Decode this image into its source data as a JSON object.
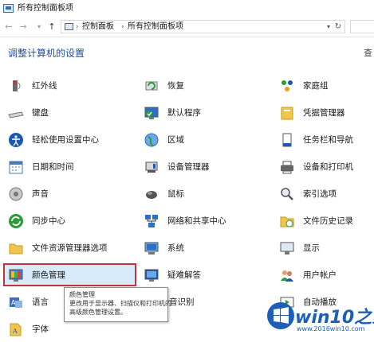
{
  "window": {
    "title": "所有控制面板项"
  },
  "nav": {
    "back": "←",
    "forward": "→",
    "up": "↑"
  },
  "address": {
    "crumbs": [
      "控制面板",
      "所有控制面板项"
    ],
    "separator": "›",
    "dropdown": "▾",
    "refresh": "↻"
  },
  "heading": "调整计算机的设置",
  "view_by": "查",
  "items": [
    {
      "label": "红外线",
      "icon": "infrared-icon"
    },
    {
      "label": "恢复",
      "icon": "recovery-icon"
    },
    {
      "label": "家庭组",
      "icon": "homegroup-icon"
    },
    {
      "label": "键盘",
      "icon": "keyboard-icon"
    },
    {
      "label": "默认程序",
      "icon": "default-programs-icon"
    },
    {
      "label": "凭据管理器",
      "icon": "credential-manager-icon"
    },
    {
      "label": "轻松使用设置中心",
      "icon": "ease-of-access-icon"
    },
    {
      "label": "区域",
      "icon": "region-icon"
    },
    {
      "label": "任务栏和导航",
      "icon": "taskbar-icon"
    },
    {
      "label": "日期和时间",
      "icon": "date-time-icon"
    },
    {
      "label": "设备管理器",
      "icon": "device-manager-icon"
    },
    {
      "label": "设备和打印机",
      "icon": "devices-printers-icon"
    },
    {
      "label": "声音",
      "icon": "sound-icon"
    },
    {
      "label": "鼠标",
      "icon": "mouse-icon"
    },
    {
      "label": "索引选项",
      "icon": "indexing-icon"
    },
    {
      "label": "同步中心",
      "icon": "sync-center-icon"
    },
    {
      "label": "网络和共享中心",
      "icon": "network-icon"
    },
    {
      "label": "文件历史记录",
      "icon": "file-history-icon"
    },
    {
      "label": "文件资源管理器选项",
      "icon": "folder-options-icon"
    },
    {
      "label": "系统",
      "icon": "system-icon"
    },
    {
      "label": "显示",
      "icon": "display-icon"
    },
    {
      "label": "颜色管理",
      "icon": "color-management-icon"
    },
    {
      "label": "疑难解答",
      "icon": "troubleshooting-icon"
    },
    {
      "label": "用户帐户",
      "icon": "user-accounts-icon"
    },
    {
      "label": "语言",
      "icon": "language-icon"
    },
    {
      "label": "音识别",
      "icon": "speech-recognition-icon"
    },
    {
      "label": "自动播放",
      "icon": "autoplay-icon"
    },
    {
      "label": "字体",
      "icon": "fonts-icon"
    }
  ],
  "tooltip": {
    "lines": [
      "颜色管理",
      "更改用于显示器、扫描仪和打印机的",
      "高级颜色管理设置。"
    ]
  },
  "watermark": {
    "brand": "win10之家",
    "url": "www.2016win10.com"
  },
  "colors": {
    "heading": "#1f4fa0",
    "selection_border": "#c0343a",
    "selection_fill": "#d7ebfa",
    "brand": "#1c5fb6"
  }
}
